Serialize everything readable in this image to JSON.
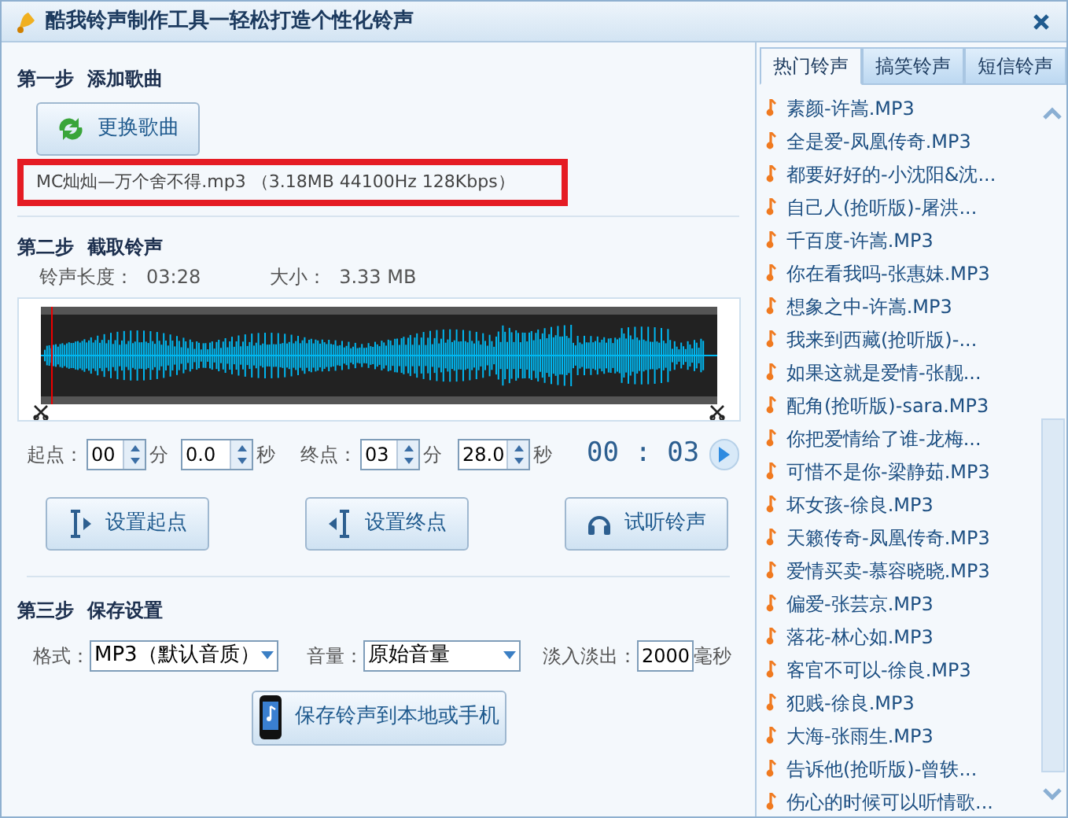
{
  "window": {
    "title": "酷我铃声制作工具一轻松打造个性化铃声"
  },
  "step1": {
    "heading": "第一步  添加歌曲",
    "button": "更换歌曲",
    "file_info": {
      "text": "MC灿灿—万个舍不得.mp3 （3.18MB 44100Hz  128Kbps）",
      "highlighted": true
    }
  },
  "step2": {
    "heading": "第二步  截取铃声",
    "length_label": "铃声长度：",
    "length": "03:28",
    "size_label": "大小：",
    "size": "3.33 MB",
    "start_label": "起点：",
    "start_min": "00",
    "min_unit": "分",
    "start_sec": "0.0",
    "sec_unit": "秒",
    "end_label": "终点：",
    "end_min": "03",
    "end_min_unit": "分",
    "end_sec": "28.0",
    "end_sec_unit": "秒",
    "time": "00 : 03",
    "buttons": [
      {
        "kind": "start",
        "label": "设置起点"
      },
      {
        "kind": "end",
        "label": "设置终点"
      },
      {
        "kind": "listen",
        "label": "试听铃声"
      }
    ]
  },
  "step3": {
    "heading": "第三步  保存设置",
    "format_label": "格式：",
    "format": "MP3（默认音质）",
    "volume_label": "音量：",
    "volume": "原始音量",
    "fade_label": "淡入淡出：",
    "fade": "2000",
    "fade_unit": "毫秒",
    "save_button": "保存铃声到本地或手机"
  },
  "tabs": [
    {
      "label": "热门铃声",
      "selected": true
    },
    {
      "label": "搞笑铃声",
      "selected": false
    },
    {
      "label": "短信铃声",
      "selected": false
    }
  ],
  "songs": [
    "素颜-许嵩.MP3",
    "全是爱-凤凰传奇.MP3",
    "都要好好的-小沈阳&沈...",
    "自己人(抢听版)-屠洪...",
    "千百度-许嵩.MP3",
    "你在看我吗-张惠妹.MP3",
    "想象之中-许嵩.MP3",
    "我来到西藏(抢听版)-...",
    "如果这就是爱情-张靓...",
    "配角(抢听版)-sara.MP3",
    "你把爱情给了谁-龙梅...",
    "可惜不是你-梁静茹.MP3",
    "坏女孩-徐良.MP3",
    "天籁传奇-凤凰传奇.MP3",
    "爱情买卖-慕容晓晓.MP3",
    "偏爱-张芸京.MP3",
    "落花-林心如.MP3",
    "客官不可以-徐良.MP3",
    "犯贱-徐良.MP3",
    "大海-张雨生.MP3",
    "告诉他(抢听版)-曾轶...",
    "伤心的时候可以听情歌..."
  ]
}
